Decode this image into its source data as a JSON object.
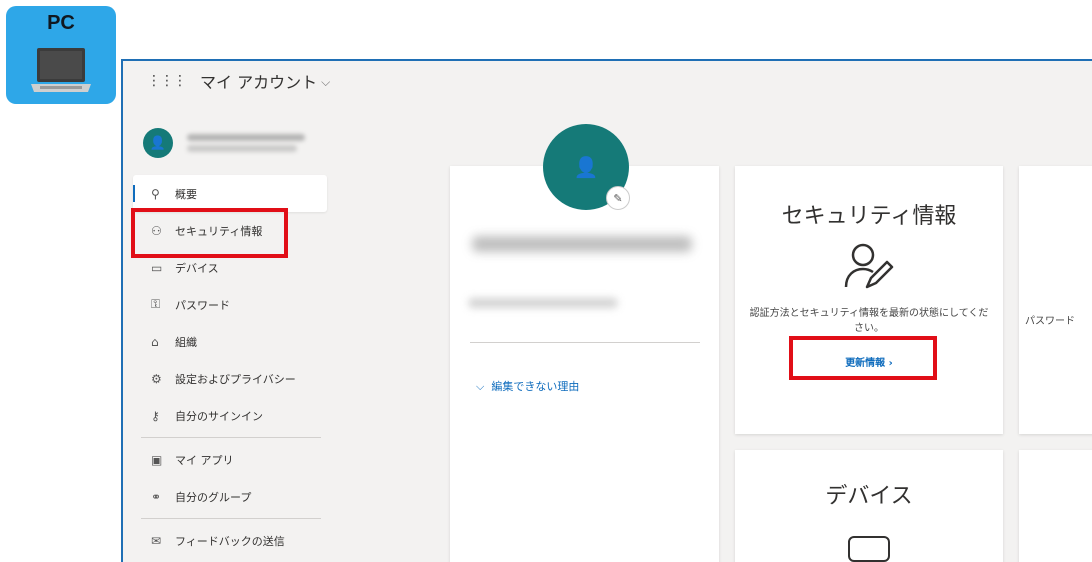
{
  "badge": {
    "label": "PC",
    "icon": "laptop-icon"
  },
  "topbar": {
    "app_title": "マイ アカウント",
    "chevron": "⌵"
  },
  "sidebar": {
    "avatar_glyph": "👤",
    "items": [
      {
        "label": "概要",
        "icon": "person-icon",
        "glyph": "⚲",
        "active": true
      },
      {
        "label": "セキュリティ情報",
        "icon": "person-edit-icon",
        "glyph": "⚇"
      },
      {
        "label": "デバイス",
        "icon": "laptop-icon",
        "glyph": "▭"
      },
      {
        "label": "パスワード",
        "icon": "key-icon",
        "glyph": "⚿"
      },
      {
        "label": "組織",
        "icon": "briefcase-icon",
        "glyph": "⌂"
      },
      {
        "label": "設定およびプライバシー",
        "icon": "gear-icon",
        "glyph": "⚙"
      },
      {
        "label": "自分のサインイン",
        "icon": "person-key-icon",
        "glyph": "⚷"
      },
      {
        "label": "マイ アプリ",
        "icon": "apps-icon",
        "glyph": "▣"
      },
      {
        "label": "自分のグループ",
        "icon": "group-icon",
        "glyph": "⚭"
      },
      {
        "label": "フィードバックの送信",
        "icon": "feedback-icon",
        "glyph": "✉"
      }
    ]
  },
  "profile": {
    "avatar_glyph": "👤",
    "edit_glyph": "✎",
    "why_link": "編集できない理由"
  },
  "security_card": {
    "title": "セキュリティ情報",
    "description": "認証方法とセキュリティ情報を最新の状態にしてください。",
    "update_link": "更新情報 ›"
  },
  "devices_card": {
    "title": "デバイス"
  },
  "password_card": {
    "label": "パスワード"
  },
  "colors": {
    "accent": "#0f6cbd",
    "avatar": "#157a78",
    "badge": "#2ea7e8",
    "highlight": "#e10e17"
  }
}
